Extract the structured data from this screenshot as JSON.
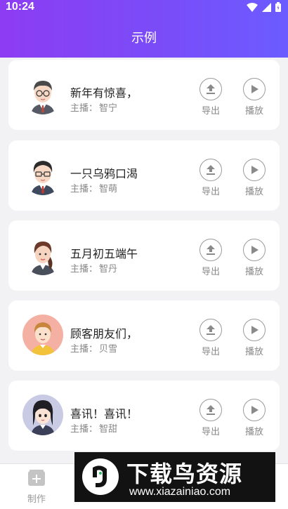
{
  "status": {
    "time": "10:24"
  },
  "header": {
    "title": "示例"
  },
  "host_prefix": "主播：",
  "actions": {
    "export_label": "导出",
    "play_label": "播放"
  },
  "items": [
    {
      "title": "新年有惊喜，",
      "host": "智宁",
      "avatar": "man-glasses-avatar"
    },
    {
      "title": "一只乌鸦口渴",
      "host": "智萌",
      "avatar": "man-glasses-avatar"
    },
    {
      "title": "五月初五端午",
      "host": "智丹",
      "avatar": "woman-ponytail-avatar"
    },
    {
      "title": "顾客朋友们，",
      "host": "贝雪",
      "avatar": "woman-pink-avatar"
    },
    {
      "title": "喜讯！喜讯！",
      "host": "智甜",
      "avatar": "girl-black-hair-avatar"
    }
  ],
  "tabbar": {
    "make_label": "制作"
  },
  "watermark": {
    "cn": "下载鸟资源",
    "url": "www.xiazainiao.com"
  },
  "colors": {
    "header_start": "#8d3cf3",
    "header_end": "#6b5cff",
    "background": "#f2f2f4"
  }
}
